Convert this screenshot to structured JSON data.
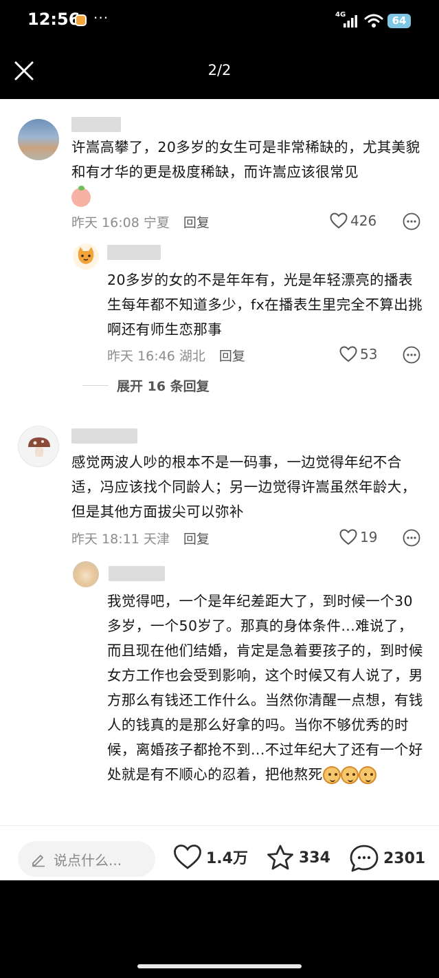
{
  "status_bar": {
    "time": "12:56",
    "more": "···",
    "network": "4G",
    "battery": "64"
  },
  "nav": {
    "page_indicator": "2/2"
  },
  "comments": [
    {
      "text": "许嵩高攀了，20多岁的女生可是非常稀缺的，尤其美貌和有才华的更是极度稀缺，而许嵩应该很常见",
      "date": "昨天 16:08",
      "location": "宁夏",
      "reply_label": "回复",
      "likes": "426",
      "reply": {
        "text": "20多岁的女的不是年年有，光是年轻漂亮的播表生每年都不知道多少，fx在播表生里完全不算出挑啊还有师生恋那事",
        "date": "昨天 16:46",
        "location": "湖北",
        "reply_label": "回复",
        "likes": "53"
      },
      "expand_label": "展开 16 条回复"
    },
    {
      "text": "感觉两波人吵的根本不是一码事，一边觉得年纪不合适，冯应该找个同龄人；另一边觉得许嵩虽然年龄大，但是其他方面拔尖可以弥补",
      "date": "昨天 18:11",
      "location": "天津",
      "reply_label": "回复",
      "likes": "19",
      "reply": {
        "text": "我觉得吧，一个是年纪差距大了，到时候一个30多岁，一个50岁了。那真的身体条件...难说了，而且现在他们结婚，肯定是急着要孩子的，到时候女方工作也会受到影响，这个时候又有人说了，男方那么有钱还工作什么。当然你清醒一点想，有钱人的钱真的是那么好拿的吗。当你不够优秀的时候，离婚孩子都抢不到...不过年纪大了还有一个好处就是有不顺心的忍着，把他熬死"
      }
    }
  ],
  "bottom_bar": {
    "input_placeholder": "说点什么...",
    "likes": "1.4万",
    "favorites": "334",
    "comments": "2301"
  }
}
